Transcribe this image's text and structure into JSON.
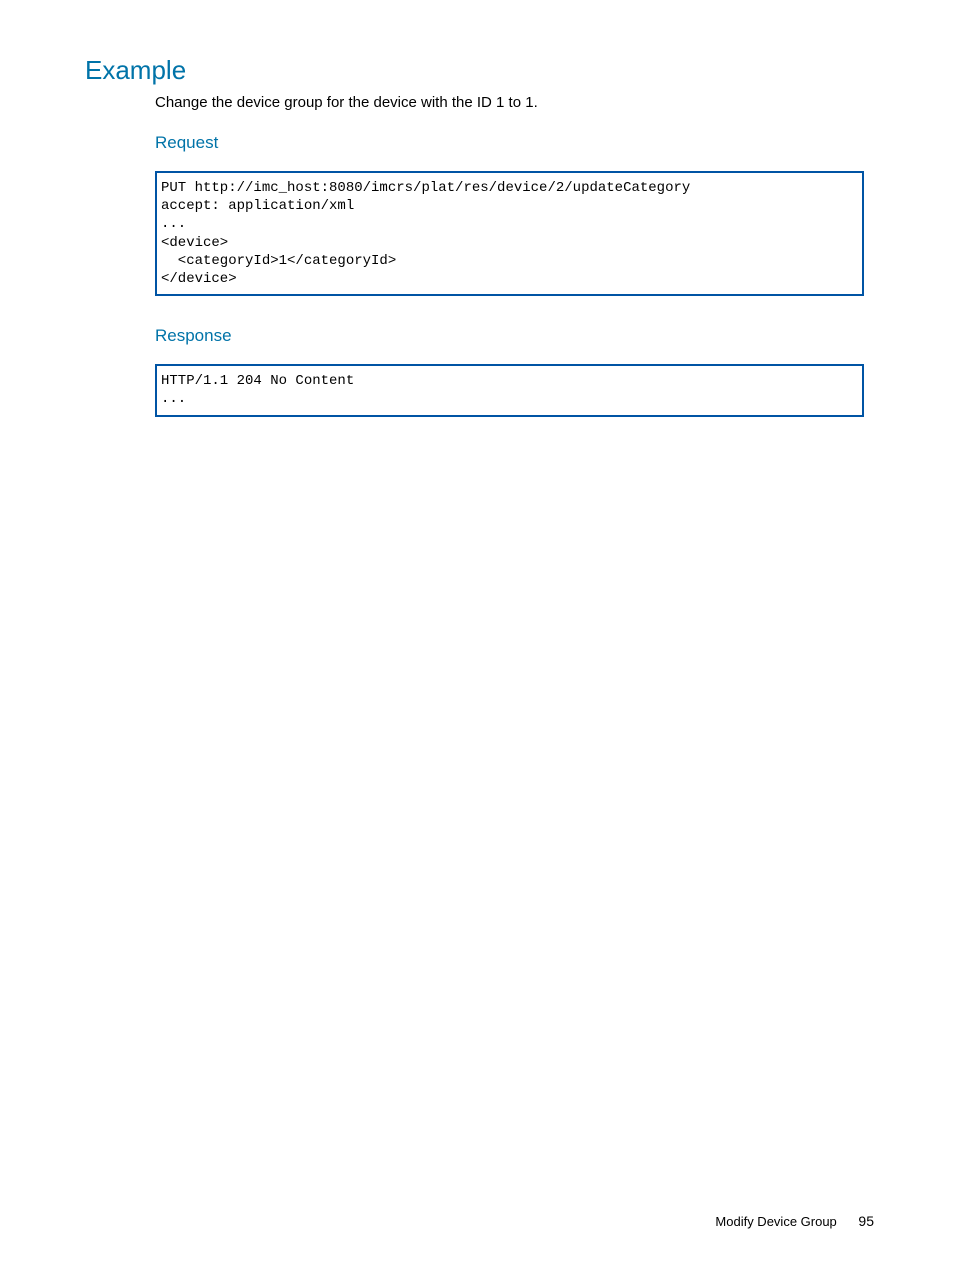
{
  "headings": {
    "example": "Example",
    "request": "Request",
    "response": "Response"
  },
  "intro": "Change the device group for the device with the ID 1 to 1.",
  "code": {
    "request": "PUT http://imc_host:8080/imcrs/plat/res/device/2/updateCategory\naccept: application/xml\n...\n<device>\n  <categoryId>1</categoryId>\n</device>",
    "response": "HTTP/1.1 204 No Content\n..."
  },
  "footer": {
    "section": "Modify Device Group",
    "page": "95"
  }
}
